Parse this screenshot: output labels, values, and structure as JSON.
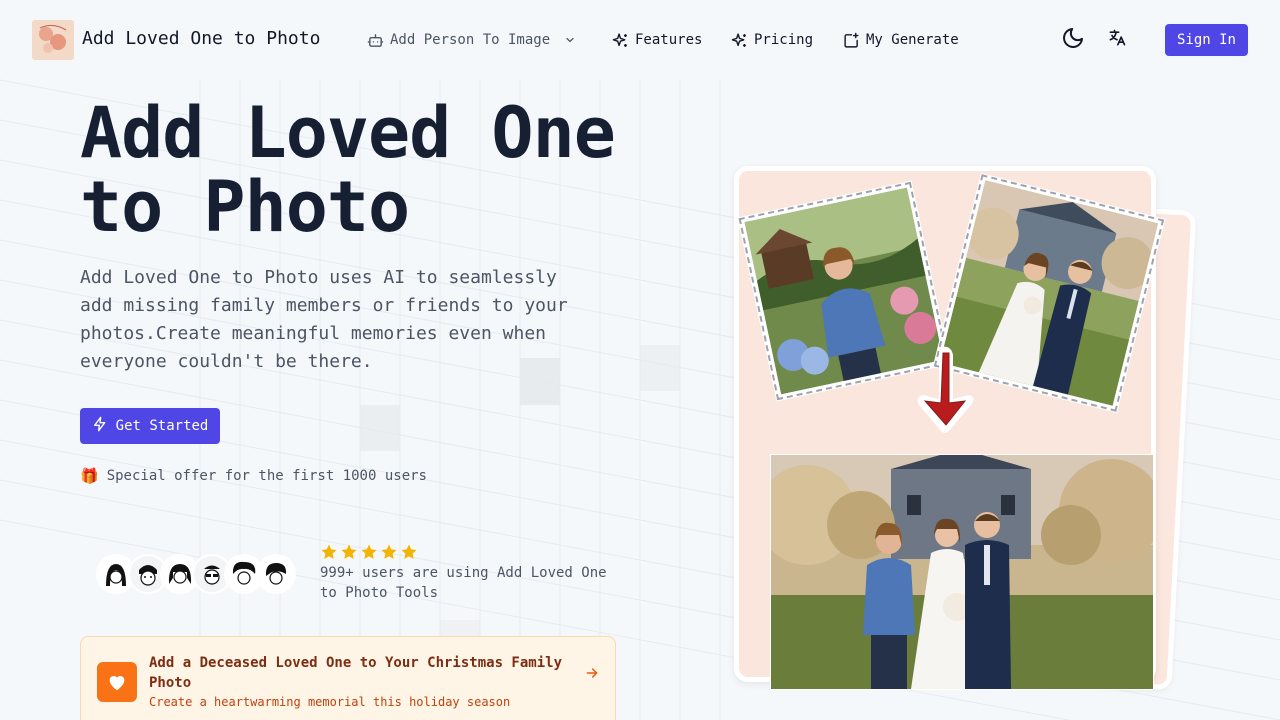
{
  "brand": {
    "name": "Add Loved One to Photo"
  },
  "nav": {
    "items": [
      {
        "label": "Add Person To Image",
        "icon": "robot-icon",
        "dropdown": true
      },
      {
        "label": "Features",
        "icon": "sparkles-icon"
      },
      {
        "label": "Pricing",
        "icon": "sparkles-icon"
      },
      {
        "label": "My Generate",
        "icon": "image-plus-icon"
      }
    ],
    "theme_toggle": "moon-icon",
    "language": "translate-icon",
    "sign_in": "Sign In"
  },
  "hero": {
    "title": "Add Loved One to Photo",
    "description": "Add Loved One to Photo uses AI to seamlessly add missing family members or friends to your photos.Create meaningful memories even when everyone couldn't be there.",
    "cta": "Get Started",
    "offer_emoji": "🎁",
    "offer": "Special offer for the first 1000 users",
    "rating_stars": 5,
    "users_text": "999+ users are using Add Loved One to Photo Tools",
    "avatar_count": 6
  },
  "promo": {
    "title": "Add a Deceased Loved One to Your Christmas Family Photo",
    "subtitle": "Create a heartwarming memorial this holiday season",
    "icon": "heart-icon"
  },
  "colors": {
    "accent": "#4f46e5",
    "star": "#f5b301",
    "promo_icon_bg": "#f97316",
    "arrow_red": "#b91c1c"
  }
}
